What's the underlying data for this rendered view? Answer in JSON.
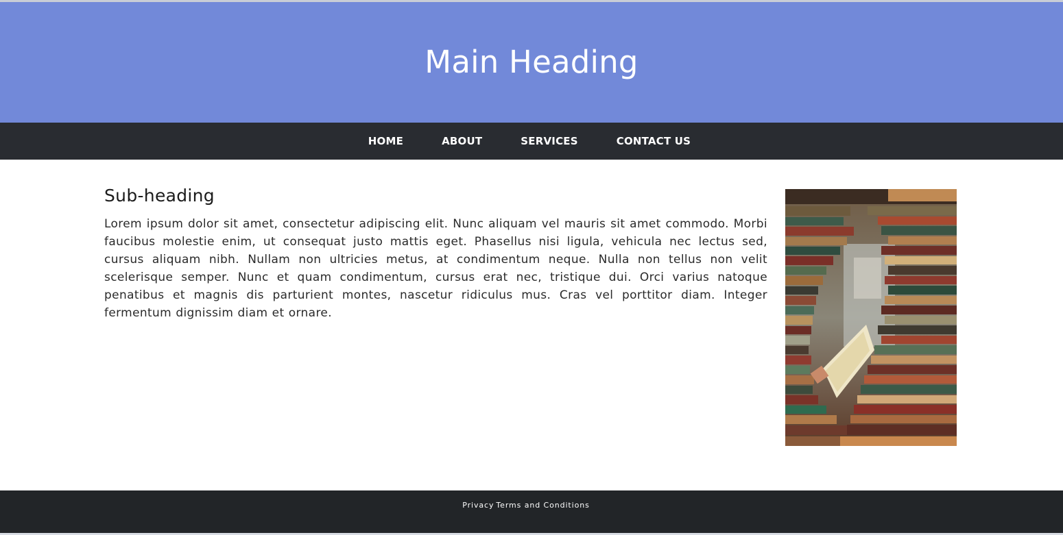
{
  "header": {
    "title": "Main Heading"
  },
  "nav": {
    "items": [
      {
        "label": "HOME"
      },
      {
        "label": "ABOUT"
      },
      {
        "label": "SERVICES"
      },
      {
        "label": "CONTACT US"
      }
    ]
  },
  "main": {
    "subheading": "Sub-heading",
    "paragraph": "Lorem ipsum dolor sit amet, consectetur adipiscing elit. Nunc aliquam vel mauris sit amet commodo. Morbi faucibus molestie enim, ut consequat justo mattis eget. Phasellus nisi ligula, vehicula nec lectus sed, cursus aliquam nibh. Nullam non ultricies metus, at condimentum neque. Nulla non tellus non velit scelerisque semper. Nunc et quam condimentum, cursus erat nec, tristique dui. Orci varius natoque penatibus et magnis dis parturient montes, nascetur ridiculus mus. Cras vel porttitor diam. Integer fermentum dignissim diam et ornare.",
    "image": {
      "subject": "stacks of old books in a bookshop"
    }
  },
  "footer": {
    "links": [
      {
        "label": "Privacy"
      },
      {
        "label": "Terms and Conditions"
      }
    ]
  },
  "colors": {
    "header_bg": "#7289d9",
    "nav_bg": "#292c31",
    "footer_bg": "#222528",
    "text": "#2a2a2a"
  }
}
